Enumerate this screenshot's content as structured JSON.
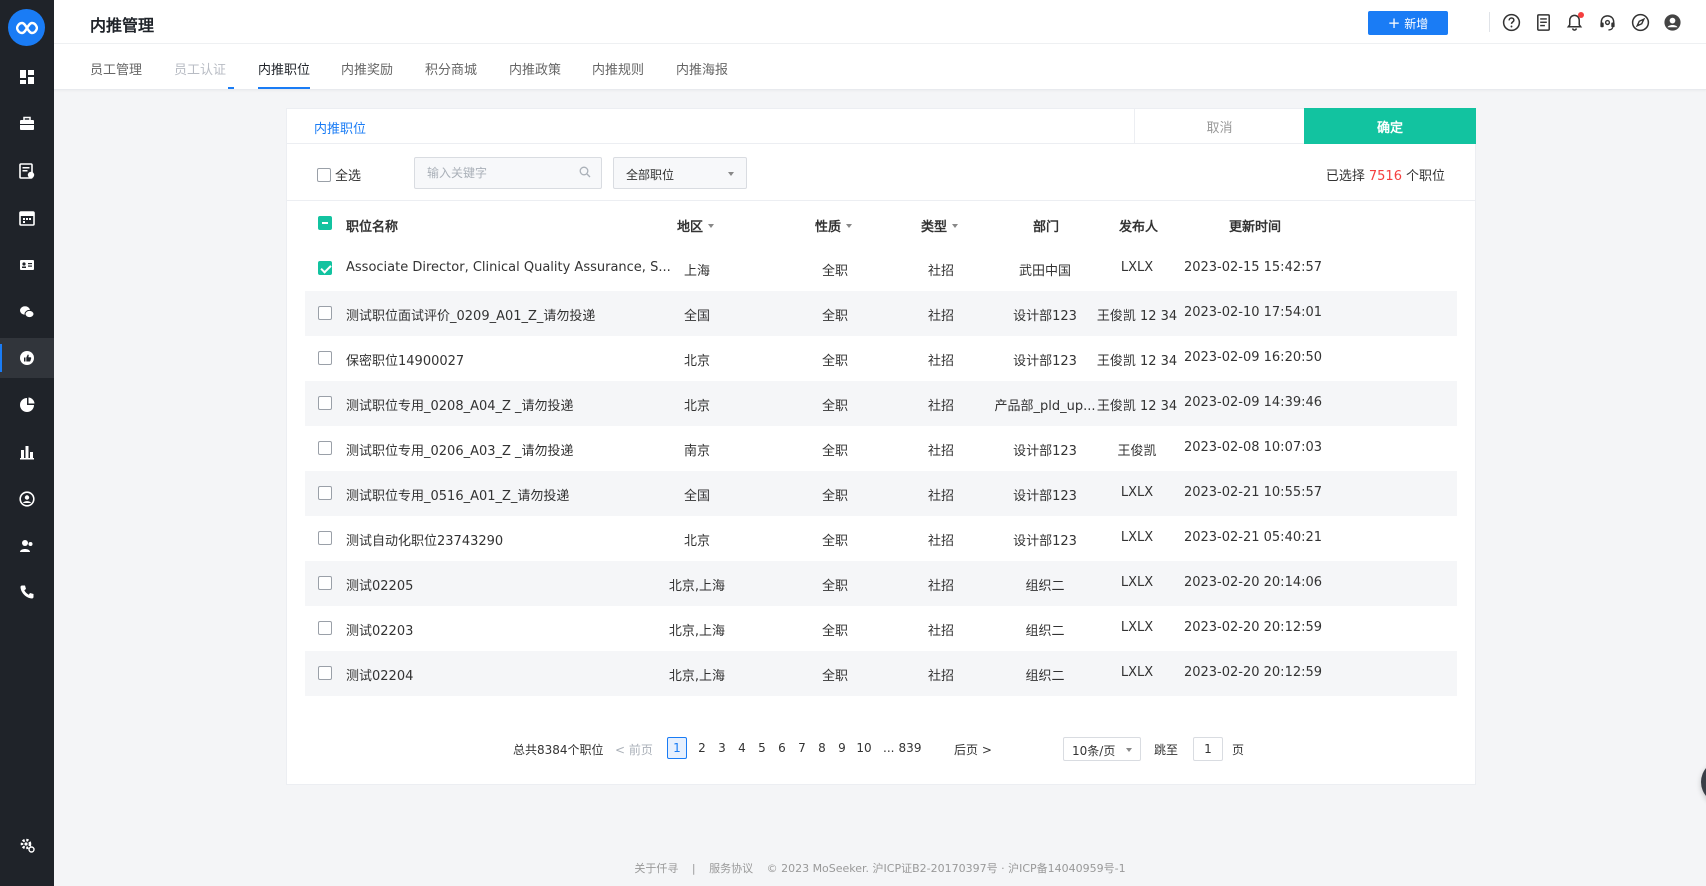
{
  "app": {
    "logo_text": "MoSeeker"
  },
  "header": {
    "title": "内推管理",
    "add_label": "新增",
    "icons": [
      "help-icon",
      "document-icon",
      "bell-icon",
      "headset-icon",
      "compass-icon",
      "user-icon"
    ]
  },
  "tabs": [
    {
      "label": "员工管理"
    },
    {
      "label": "员工认证"
    },
    {
      "label": "内推职位"
    },
    {
      "label": "内推奖励"
    },
    {
      "label": "积分商城"
    },
    {
      "label": "内推政策"
    },
    {
      "label": "内推规则"
    },
    {
      "label": "内推海报"
    }
  ],
  "panel": {
    "title": "内推职位",
    "cancel_label": "取消",
    "ok_label": "确定"
  },
  "filter": {
    "select_all_label": "全选",
    "search_placeholder": "输入关键字",
    "position_select": "全部职位",
    "selected_prefix": "已选择",
    "selected_count": "7516",
    "selected_suffix": "个职位"
  },
  "table": {
    "columns": [
      "职位名称",
      "地区",
      "性质",
      "类型",
      "部门",
      "发布人",
      "更新时间"
    ],
    "rows": [
      {
        "checked": true,
        "name": "Associate Director, Clinical Quality Assurance, S...",
        "region": "上海",
        "nature": "全职",
        "type": "社招",
        "dept": "武田中国",
        "publisher": "LXLX",
        "updated": "2023-02-15 15:42:57"
      },
      {
        "checked": false,
        "name": "测试职位面试评价_0209_A01_Z_请勿投递",
        "region": "全国",
        "nature": "全职",
        "type": "社招",
        "dept": "设计部123",
        "publisher": "王俊凯 12 34",
        "updated": "2023-02-10 17:54:01"
      },
      {
        "checked": false,
        "name": "保密职位14900027",
        "region": "北京",
        "nature": "全职",
        "type": "社招",
        "dept": "设计部123",
        "publisher": "王俊凯 12 34",
        "updated": "2023-02-09 16:20:50"
      },
      {
        "checked": false,
        "name": "测试职位专用_0208_A04_Z _请勿投递",
        "region": "北京",
        "nature": "全职",
        "type": "社招",
        "dept": "产品部_pld_up...",
        "publisher": "王俊凯 12 34",
        "updated": "2023-02-09 14:39:46"
      },
      {
        "checked": false,
        "name": "测试职位专用_0206_A03_Z _请勿投递",
        "region": "南京",
        "nature": "全职",
        "type": "社招",
        "dept": "设计部123",
        "publisher": "王俊凯",
        "updated": "2023-02-08 10:07:03"
      },
      {
        "checked": false,
        "name": "测试职位专用_0516_A01_Z_请勿投递",
        "region": "全国",
        "nature": "全职",
        "type": "社招",
        "dept": "设计部123",
        "publisher": "LXLX",
        "updated": "2023-02-21 10:55:57"
      },
      {
        "checked": false,
        "name": "测试自动化职位23743290",
        "region": "北京",
        "nature": "全职",
        "type": "社招",
        "dept": "设计部123",
        "publisher": "LXLX",
        "updated": "2023-02-21 05:40:21"
      },
      {
        "checked": false,
        "name": "测试02205",
        "region": "北京,上海",
        "nature": "全职",
        "type": "社招",
        "dept": "组织二",
        "publisher": "LXLX",
        "updated": "2023-02-20 20:14:06"
      },
      {
        "checked": false,
        "name": "测试02203",
        "region": "北京,上海",
        "nature": "全职",
        "type": "社招",
        "dept": "组织二",
        "publisher": "LXLX",
        "updated": "2023-02-20 20:12:59"
      },
      {
        "checked": false,
        "name": "测试02204",
        "region": "北京,上海",
        "nature": "全职",
        "type": "社招",
        "dept": "组织二",
        "publisher": "LXLX",
        "updated": "2023-02-20 20:12:59"
      }
    ]
  },
  "pagination": {
    "total": "总共8384个职位",
    "prev": "< 前页",
    "pages": [
      "1",
      "2",
      "3",
      "4",
      "5",
      "6",
      "7",
      "8",
      "9",
      "10"
    ],
    "ellipsis": "...",
    "last_page": "839",
    "current": "1",
    "next": "后页 >",
    "page_size": "10条/页",
    "jump_label": "跳至",
    "jump_value": "1",
    "jump_suffix": "页"
  },
  "footer": {
    "about": "关于仟寻",
    "separator": "|",
    "terms": "服务协议",
    "copyright": "© 2023 MoSeeker. 沪ICP证B2-20170397号 · 沪ICP备14040959号-1"
  },
  "colors": {
    "primary": "#1a7cf5",
    "confirm": "#12c3a0",
    "sidebar": "#1f2329",
    "highlight": "#f53f3f"
  }
}
